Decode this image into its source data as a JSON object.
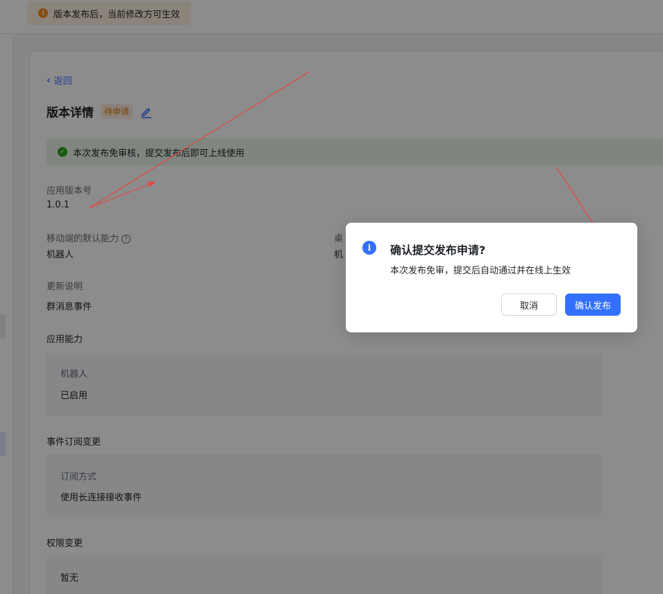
{
  "banner": {
    "text": "版本发布后，当前修改方可生效"
  },
  "page": {
    "back_label": "返回",
    "title": "版本详情",
    "status_tag": "待申请",
    "notice": "本次发布免审核，提交发布后即可上线使用"
  },
  "fields": {
    "version_label": "应用版本号",
    "version_value": "1.0.1",
    "mobile_cap_label": "移动端的默认能力",
    "mobile_cap_value": "机器人",
    "desktop_cap_label": "桌",
    "desktop_cap_value": "机",
    "changelog_label": "更新说明",
    "changelog_value": "群消息事件"
  },
  "sections": {
    "capabilities": {
      "title": "应用能力",
      "item_label": "机器人",
      "item_value": "已启用"
    },
    "events": {
      "title": "事件订阅变更",
      "item_label": "订阅方式",
      "item_value": "使用长连接接收事件"
    },
    "permissions": {
      "title": "权限变更",
      "item_value": "暂无"
    }
  },
  "dialog": {
    "title": "确认提交发布申请?",
    "body": "本次发布免审，提交后自动通过并在线上生效",
    "cancel_label": "取消",
    "confirm_label": "确认发布"
  },
  "colors": {
    "primary": "#3370ff",
    "warning": "#f08a24",
    "success": "#2ea121",
    "annotation": "#e5453d"
  }
}
